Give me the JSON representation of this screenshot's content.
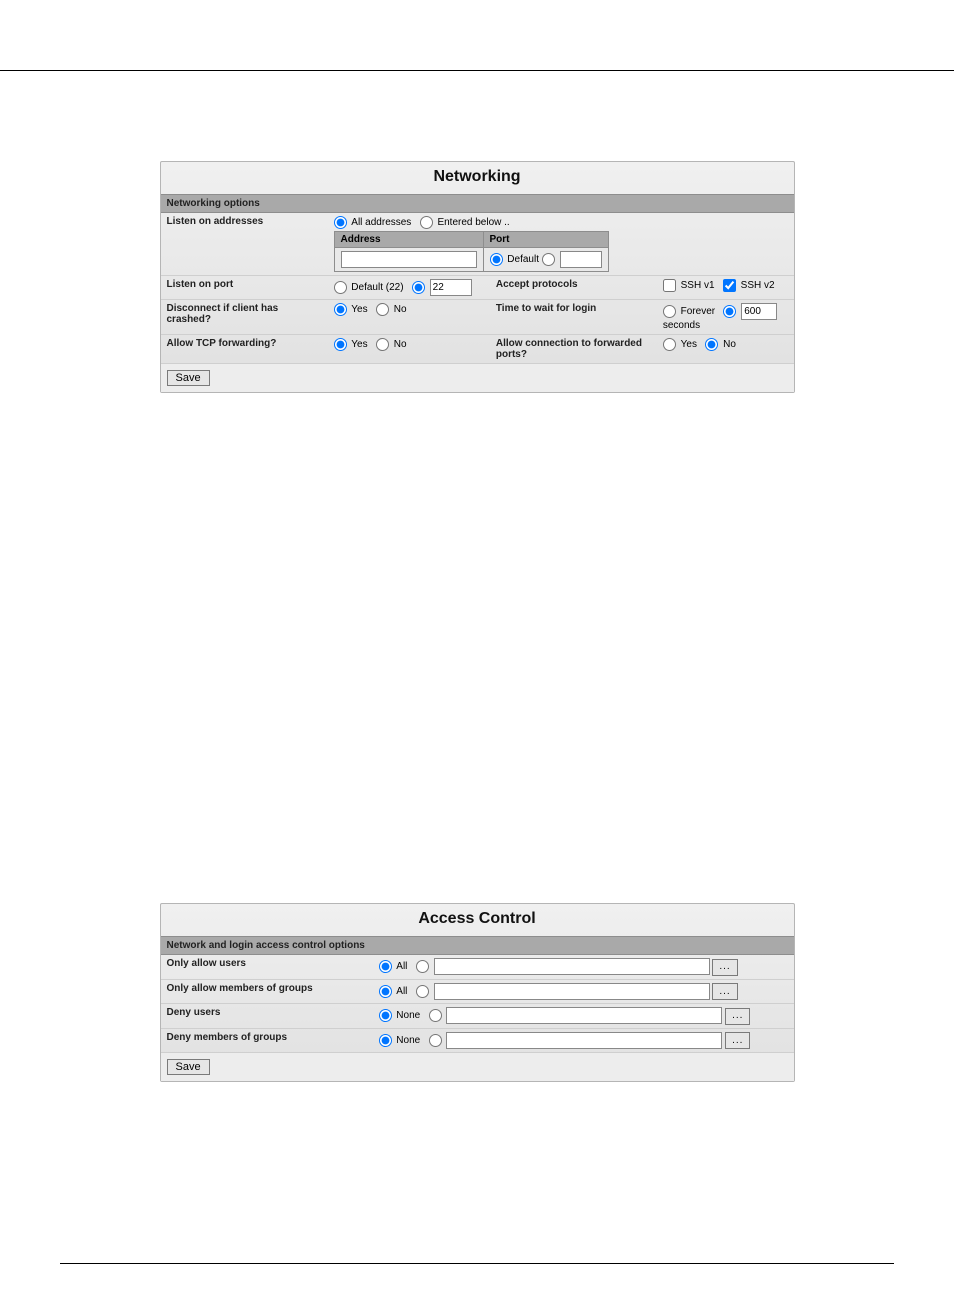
{
  "networking": {
    "title": "Networking",
    "section": "Networking options",
    "listen_addresses": {
      "label": "Listen on addresses",
      "all_label": "All addresses",
      "entered_label": "Entered below ..",
      "selected": "all",
      "addr_header": "Address",
      "port_header": "Port",
      "addr_value": "",
      "port_default_label": "Default",
      "port_mode": "default",
      "port_value": ""
    },
    "listen_port": {
      "label": "Listen on port",
      "default_label": "Default (22)",
      "mode": "custom",
      "value": "22"
    },
    "accept_protocols": {
      "label": "Accept protocols",
      "ssh1_label": "SSH v1",
      "ssh1_checked": false,
      "ssh2_label": "SSH v2",
      "ssh2_checked": true
    },
    "disconnect_crash": {
      "label": "Disconnect if client has crashed?",
      "yes": "Yes",
      "no": "No",
      "value": "yes"
    },
    "time_wait": {
      "label": "Time to wait for login",
      "forever_label": "Forever",
      "mode": "seconds",
      "value": "600",
      "unit": "seconds"
    },
    "tcp_forward": {
      "label": "Allow TCP forwarding?",
      "yes": "Yes",
      "no": "No",
      "value": "yes"
    },
    "fwd_ports": {
      "label": "Allow connection to forwarded ports?",
      "yes": "Yes",
      "no": "No",
      "value": "no"
    },
    "save": "Save"
  },
  "access": {
    "title": "Access Control",
    "section": "Network and login access control options",
    "rows": [
      {
        "label": "Only allow users",
        "opt": "All",
        "mode": "all",
        "value": ""
      },
      {
        "label": "Only allow members of groups",
        "opt": "All",
        "mode": "all",
        "value": ""
      },
      {
        "label": "Deny users",
        "opt": "None",
        "mode": "none",
        "value": ""
      },
      {
        "label": "Deny members of groups",
        "opt": "None",
        "mode": "none",
        "value": ""
      }
    ],
    "browse": "...",
    "save": "Save"
  }
}
